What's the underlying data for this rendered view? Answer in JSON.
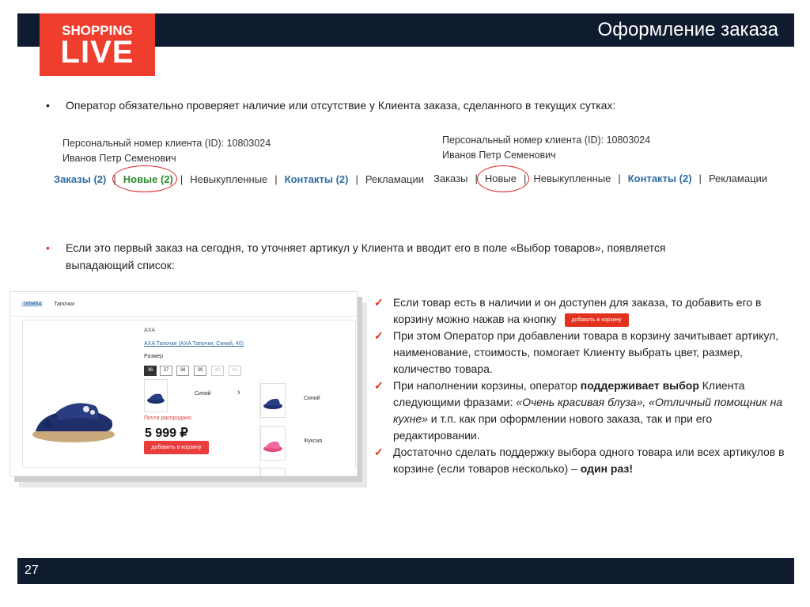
{
  "header": {
    "title": "Оформление заказа"
  },
  "logo": {
    "top": "SHOPPING",
    "main": "LIVE"
  },
  "bullets": [
    {
      "dot": "•",
      "text": "Оператор обязательно проверяет наличие или отсутствие у Клиента заказа, сделанного в текущих сутках:"
    },
    {
      "dot": "•",
      "line1": "Если это первый заказ на сегодня, то уточняет артикул у Клиента и вводит его в поле «Выбор товаров», появляется",
      "line2": "выпадающий список:"
    }
  ],
  "panel_left": {
    "id_line": "Персональный номер клиента (ID): 10803024",
    "name_line": "Иванов Петр Семенович",
    "tabs": [
      "Заказы (2)",
      "Новые (2)",
      "Невыкупленные",
      "Контакты (2)",
      "Рекламации"
    ],
    "sep": "|"
  },
  "panel_right": {
    "id_line": "Персональный номер клиента (ID): 10803024",
    "name_line": "Иванов Петр Семенович",
    "tabs": [
      "Заказы",
      "Новые",
      "Невыкупленные",
      "Контакты (2)",
      "Рекламации"
    ],
    "sep": "|"
  },
  "product_screenshot": {
    "search_code": "165854",
    "search_title": "Тапочки",
    "brand": "AXA",
    "product_link": "AXA Тапочки (AXA Тапочки, Синий, 40)",
    "size_label": "Размер",
    "sizes": [
      "36",
      "37",
      "38",
      "39",
      "40",
      "41"
    ],
    "color_selected": "Синий",
    "chevron": "›",
    "stock_note": "Почти распродано",
    "price": "5 999 ₽",
    "add_button": "добавить в корзину",
    "variants": [
      "Синий",
      "Фуксия"
    ]
  },
  "checks": {
    "mark": "✓",
    "item1": "Если товар есть в наличии и он доступен для заказа, то добавить его в корзину можно нажав на кнопку",
    "item1_button": "добавить в корзину",
    "item2": "При этом Оператор при добавлении товара в корзину зачитывает артикул, наименование, стоимость, помогает Клиенту выбрать цвет, размер, количество товара.",
    "item3_a": "При наполнении корзины, оператор ",
    "item3_bold": "поддерживает выбор",
    "item3_b": " Клиента следующими фразами: ",
    "item3_italic": "«Очень красивая блуза», «Отличный помощник на кухне»",
    "item3_c": " и т.п. как при оформлении нового заказа, так и при его редактировании.",
    "item4_a": "Достаточно сделать поддержку выбора одного товара или всех артикулов в корзине (если товаров несколько) – ",
    "item4_bold": "один раз!"
  },
  "footer": {
    "page": "27"
  },
  "colors": {
    "navy": "#0f1b2e",
    "brand_red": "#f03e2e",
    "link_blue": "#2e6da4",
    "active_green": "#2e8b2e",
    "circle_red": "#e21b1b"
  }
}
